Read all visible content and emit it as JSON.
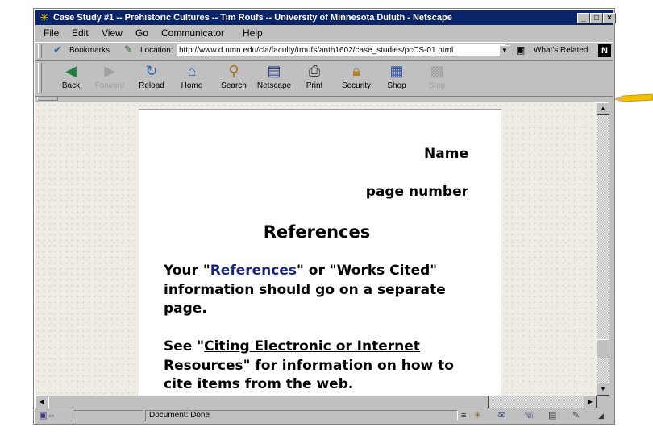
{
  "window": {
    "title": "Case Study #1 -- Prehistoric Cultures -- Tim Roufs -- University of Minnesota Duluth - Netscape",
    "controls": {
      "minimize": "_",
      "maximize": "□",
      "close": "×"
    }
  },
  "menu": [
    "File",
    "Edit",
    "View",
    "Go",
    "Communicator",
    "Help"
  ],
  "location_bar": {
    "bookmarks_label": "Bookmarks",
    "location_label": "Location:",
    "url": "http://www.d.umn.edu/cla/faculty/troufs/anth1602/case_studies/pcCS-01.html",
    "whats_related": "What's Related",
    "netscape_logo": "N"
  },
  "nav_buttons": [
    {
      "label": "Back",
      "icon": "back-arrow-icon",
      "enabled": true
    },
    {
      "label": "Forward",
      "icon": "forward-arrow-icon",
      "enabled": false
    },
    {
      "label": "Reload",
      "icon": "reload-icon",
      "enabled": true
    },
    {
      "label": "Home",
      "icon": "home-icon",
      "enabled": true
    },
    {
      "label": "Search",
      "icon": "search-icon",
      "enabled": true
    },
    {
      "label": "Netscape",
      "icon": "netscape-icon",
      "enabled": true
    },
    {
      "label": "Print",
      "icon": "print-icon",
      "enabled": true
    },
    {
      "label": "Security",
      "icon": "security-lock-icon",
      "enabled": true
    },
    {
      "label": "Shop",
      "icon": "shop-icon",
      "enabled": true
    },
    {
      "label": "Stop",
      "icon": "stop-icon",
      "enabled": false
    }
  ],
  "page": {
    "name_label": "Name",
    "page_number_label": "page number",
    "heading": "References",
    "para1": {
      "pre": "Your \"",
      "link": "References",
      "post": "\" or \"Works Cited\" information should go on a separate page."
    },
    "para2": {
      "pre": "See \"",
      "link": "Citing Electronic or Internet Resources",
      "post": "\" for information on how to cite items from the web."
    }
  },
  "status": {
    "text": "Document: Done"
  },
  "colors": {
    "titlebar": "#0a246a",
    "chrome": "#c0c0c0",
    "link": "#1a237e",
    "page_bg": "#efece4"
  }
}
